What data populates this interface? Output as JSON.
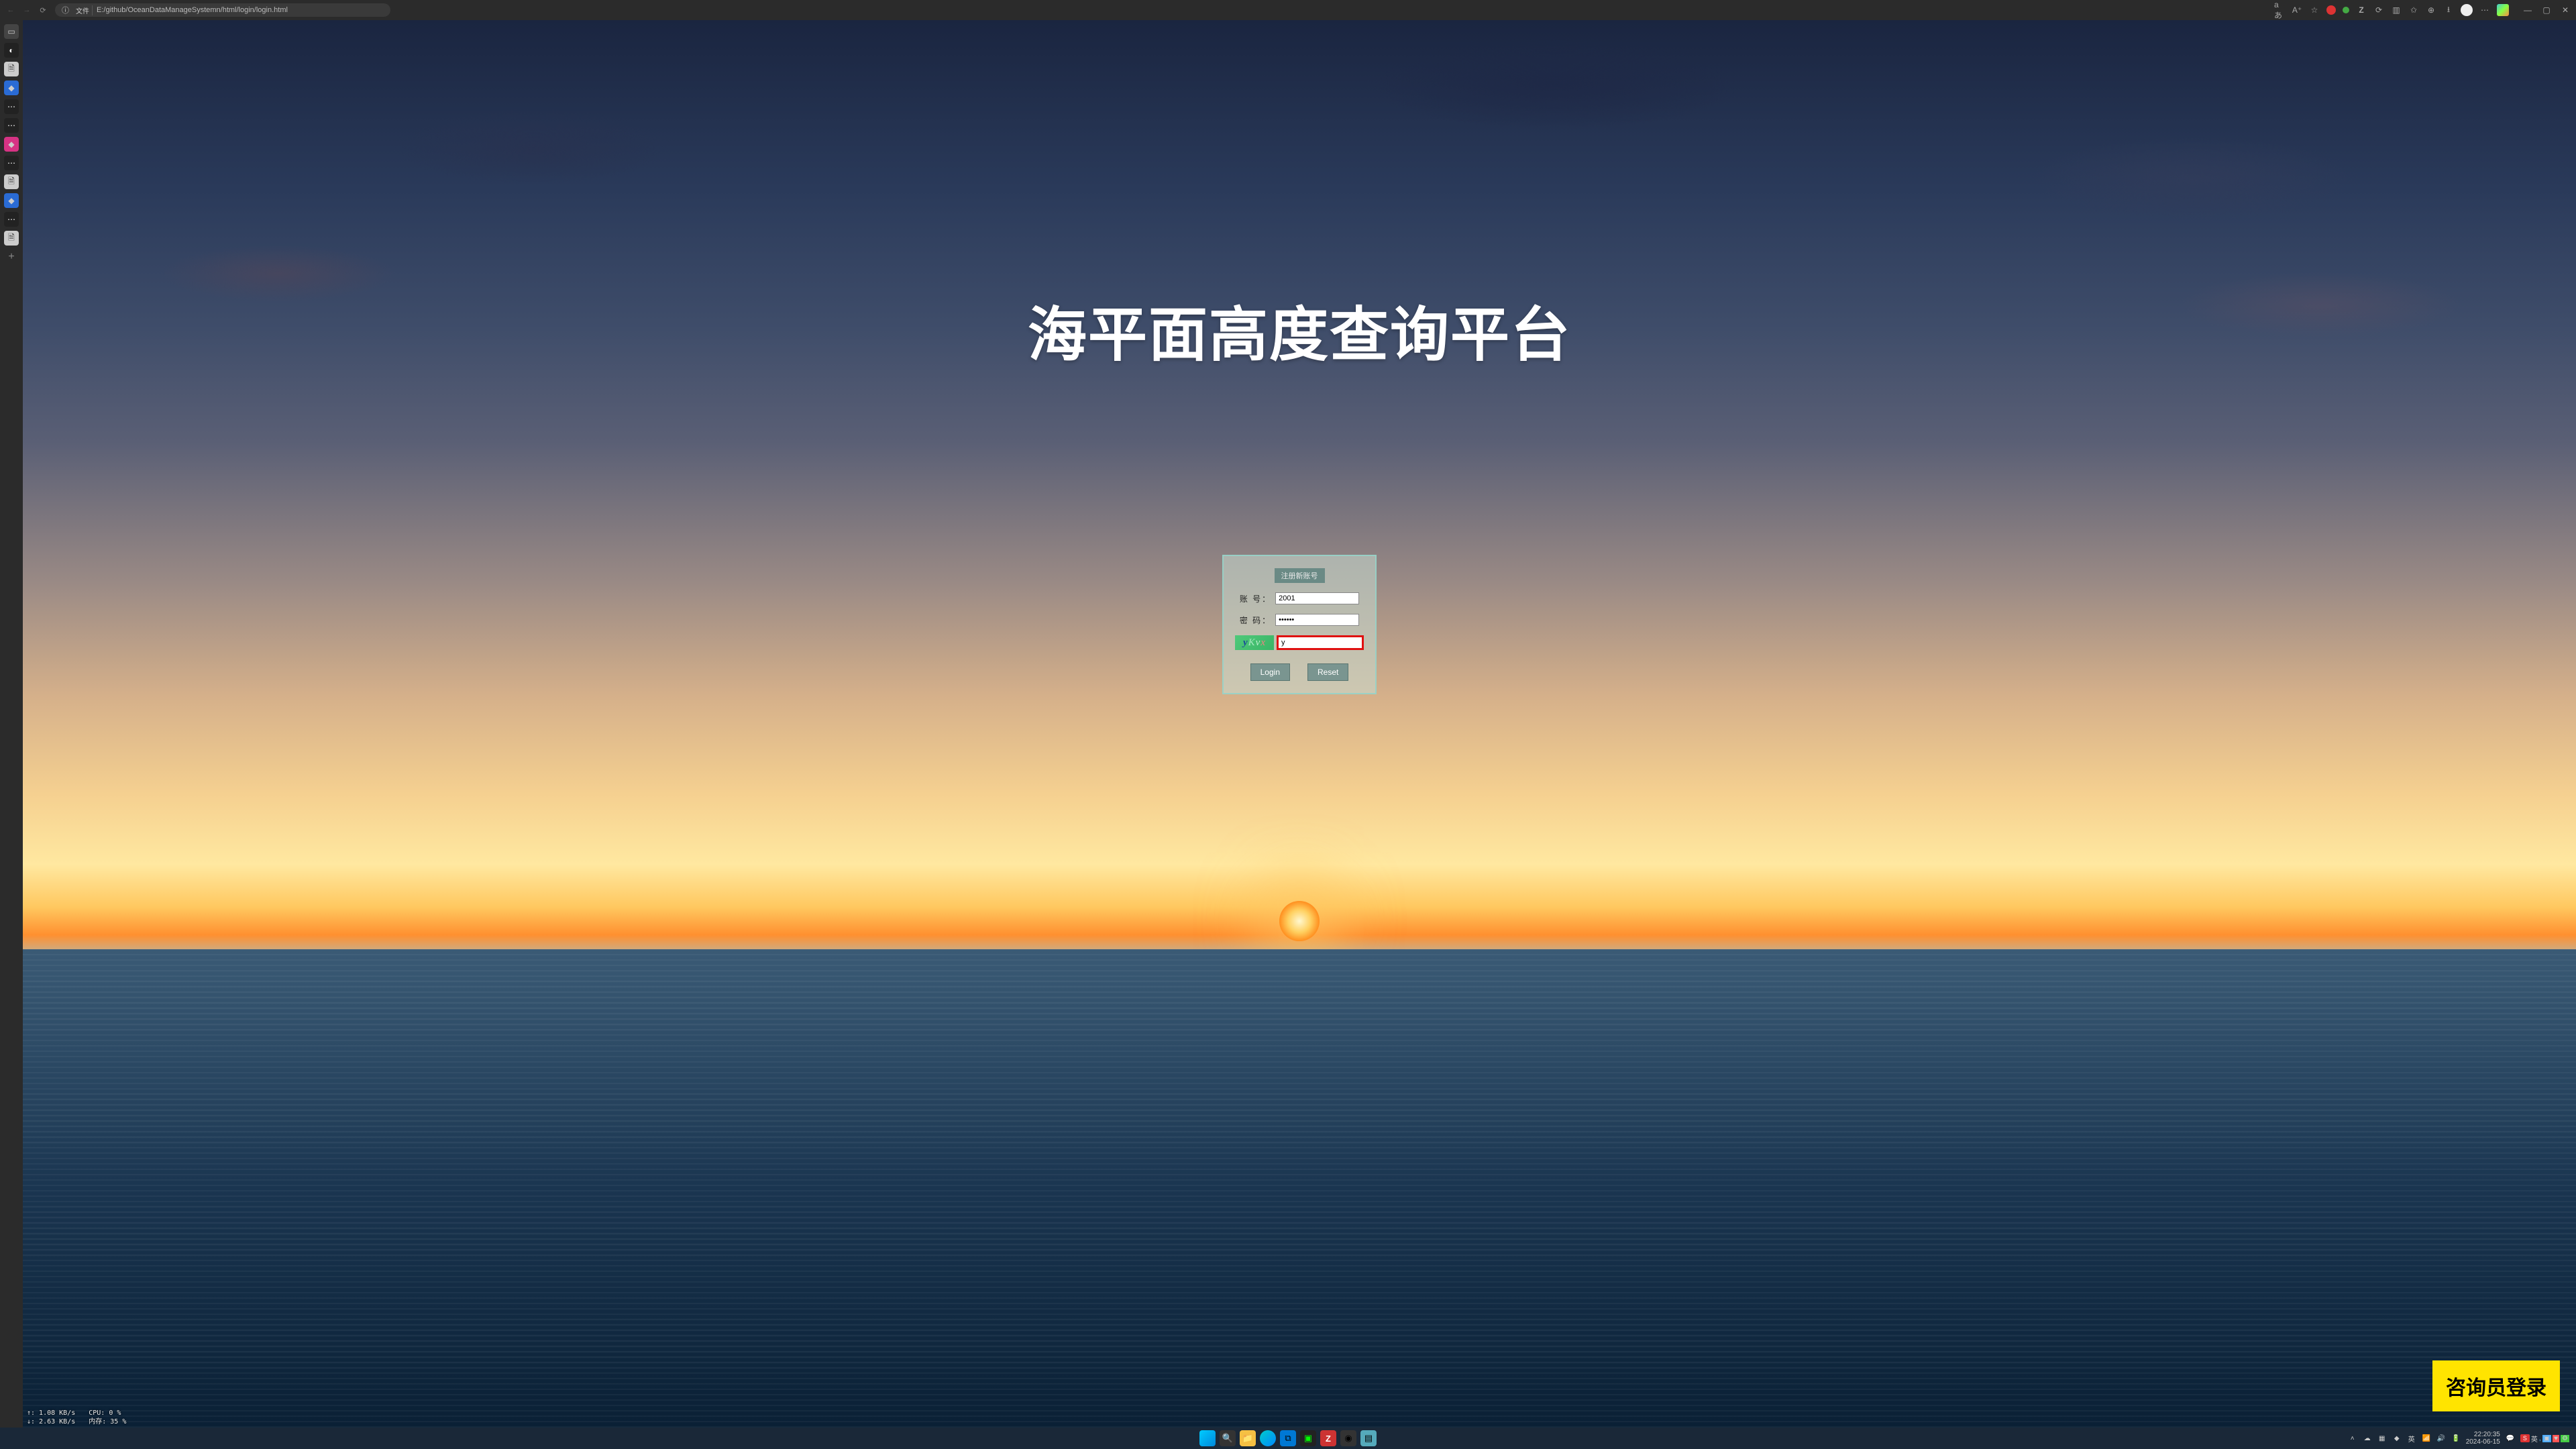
{
  "browser": {
    "file_tag": "文件",
    "url": "E:/github/OceanDataManageSystemn/html/login/login.html",
    "zoom": "aあ"
  },
  "page": {
    "title": "海平面高度查询平台",
    "register_label": "注册新账号",
    "account_label": "账 号：",
    "account_value": "2001",
    "password_label": "密 码：",
    "password_value": "••••••",
    "captcha_chars": [
      "y",
      "K",
      "v",
      "x"
    ],
    "captcha_input_value": "y",
    "login_label": "Login",
    "reset_label": "Reset",
    "consultant_label": "咨询员登录"
  },
  "perf": {
    "up": "↑: 1.08 KB/s",
    "down": "↓: 2.63 KB/s",
    "cpu": "CPU: 0 %",
    "mem": "内存: 35 %"
  },
  "tray": {
    "ime1": "英",
    "ime_badge": "S",
    "ime2": "英",
    "time": "22:20:35",
    "date": "2024-06-15"
  }
}
